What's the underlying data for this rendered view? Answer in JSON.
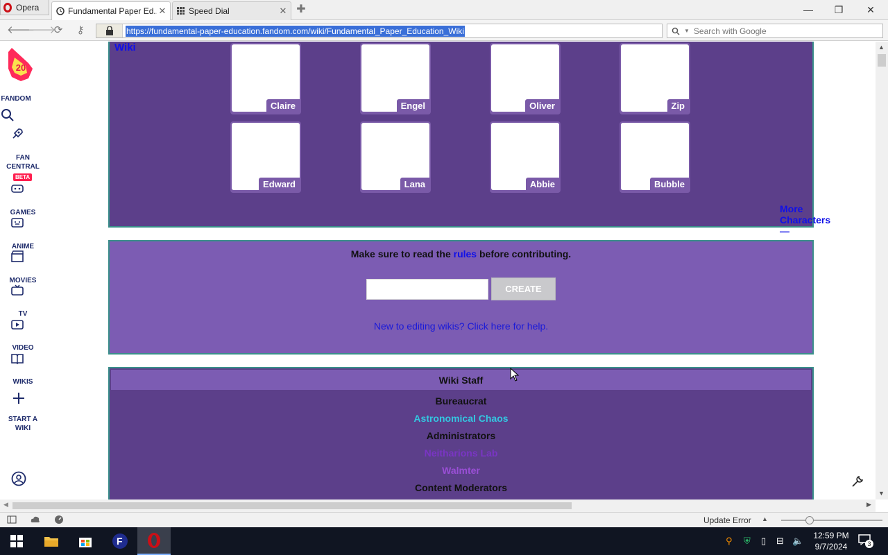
{
  "browser": {
    "menu_label": "Opera",
    "tabs": [
      {
        "label": "Fundamental Paper Ed...",
        "active": true
      },
      {
        "label": "Speed Dial",
        "active": false
      }
    ],
    "url": "https://fundamental-paper-education.fandom.com/wiki/Fundamental_Paper_Education_Wiki",
    "search_placeholder": "Search with Google"
  },
  "rail": {
    "badge_number": "20",
    "fandom_label": "FANDOM",
    "fan_central_line1": "FAN",
    "fan_central_line2": "CENTRAL",
    "beta": "BETA",
    "games": "GAMES",
    "anime": "ANIME",
    "movies": "MOVIES",
    "tv": "TV",
    "video": "VIDEO",
    "wikis": "WIKIS",
    "start_wiki_line1": "START A",
    "start_wiki_line2": "WIKI"
  },
  "characters": {
    "wiki_label": "Wiki",
    "row1": [
      "Claire",
      "Engel",
      "Oliver",
      "Zip"
    ],
    "row2": [
      "Edward",
      "Lana",
      "Abbie",
      "Bubble"
    ],
    "more": "More Characters —"
  },
  "contribute": {
    "rules_before": "Make sure to read the ",
    "rules_link": "rules",
    "rules_after": " before contributing.",
    "create_button": "CREATE",
    "help_link": "New to editing wikis? Click here for help."
  },
  "staff": {
    "heading": "Wiki Staff",
    "bureaucrat_title": "Bureaucrat",
    "bureaucrat_name": "Astronomical Chaos",
    "admins_title": "Administrators",
    "admin1": "Neitharions Lab",
    "admin2": "Walmter",
    "mods_title": "Content Moderators"
  },
  "colors": {
    "box_dark": "#5c3f8a",
    "box_light": "#7c5cb3",
    "link_blue": "#1010e8",
    "bureaucrat_cyan": "#34c6e0",
    "admin_purple": "#9a4fd6"
  },
  "status": {
    "update_error": "Update Error"
  },
  "taskbar": {
    "time": "12:59 PM",
    "date": "9/7/2024",
    "notifications": "3"
  }
}
